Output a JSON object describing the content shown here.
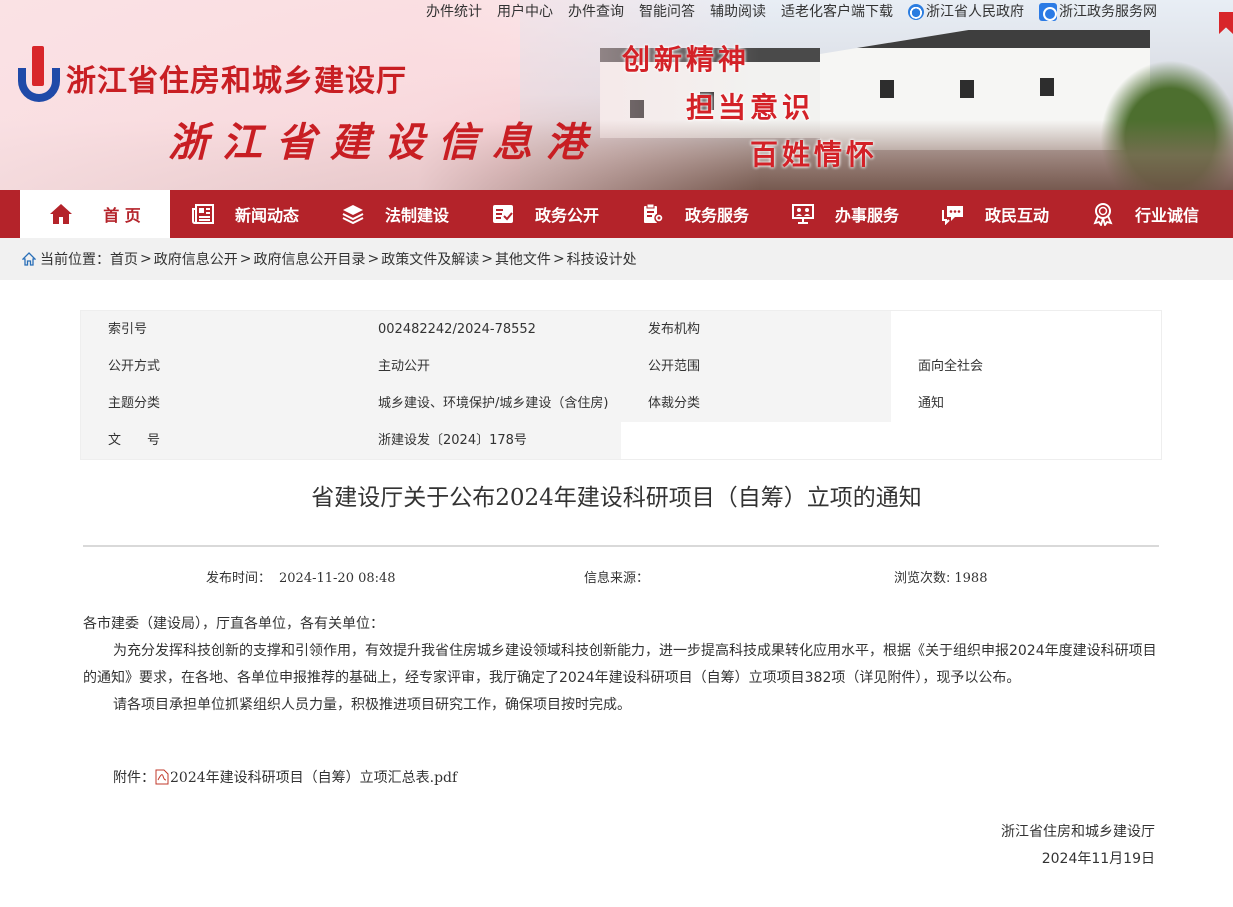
{
  "topbar": {
    "links": [
      "办件统计",
      "用户中心",
      "办件查询",
      "智能问答",
      "辅助阅读",
      "适老化客户端下载"
    ],
    "gov_link": "浙江省人民政府",
    "service_link": "浙江政务服务网"
  },
  "banner": {
    "org_name": "浙江省住房和城乡建设厅",
    "site_name": "浙江省建设信息港",
    "slogans": [
      "创新精神",
      "担当意识",
      "百姓情怀"
    ]
  },
  "nav": {
    "items": [
      {
        "label": "首 页",
        "icon": "home-icon"
      },
      {
        "label": "新闻动态",
        "icon": "newspaper-icon"
      },
      {
        "label": "法制建设",
        "icon": "layers-icon"
      },
      {
        "label": "政务公开",
        "icon": "document-check-icon"
      },
      {
        "label": "政务服务",
        "icon": "service-clipboard-icon"
      },
      {
        "label": "办事服务",
        "icon": "people-screen-icon"
      },
      {
        "label": "政民互动",
        "icon": "chat-icon"
      },
      {
        "label": "行业诚信",
        "icon": "award-ribbon-icon"
      }
    ],
    "colors": {
      "bar": "#b4232a",
      "active_bg": "#ffffff"
    }
  },
  "breadcrumb": {
    "prefix": "当前位置：",
    "items": [
      "首页",
      "政府信息公开",
      "政府信息公开目录",
      "政策文件及解读",
      "其他文件",
      "科技设计处"
    ],
    "separator": ">"
  },
  "meta": {
    "rows": [
      [
        "索引号",
        "002482242/2024-78552",
        "发布机构",
        ""
      ],
      [
        "公开方式",
        "主动公开",
        "公开范围",
        "面向全社会"
      ],
      [
        "主题分类",
        "城乡建设、环境保护/城乡建设（含住房)",
        "体裁分类",
        "通知"
      ],
      [
        "文　　号",
        "浙建设发〔2024〕178号",
        "",
        ""
      ]
    ]
  },
  "article": {
    "title": "省建设厅关于公布2024年建设科研项目（自筹）立项的通知",
    "publish_label": "发布时间：",
    "publish_time": "2024-11-20 08:48",
    "source_label": "信息来源：",
    "source_value": "",
    "views_label": "浏览次数:",
    "views": "1988",
    "salutation": "各市建委（建设局），厅直各单位，各有关单位：",
    "paragraph1": "为充分发挥科技创新的支撑和引领作用，有效提升我省住房城乡建设领域科技创新能力，进一步提高科技成果转化应用水平，根据《关于组织申报2024年度建设科研项目的通知》要求，在各地、各单位申报推荐的基础上，经专家评审，我厅确定了2024年建设科研项目（自筹）立项项目382项（详见附件），现予以公布。",
    "paragraph2": "请各项目承担单位抓紧组织人员力量，积极推进项目研究工作，确保项目按时完成。",
    "attachment_label": "附件：",
    "attachment_name": "2024年建设科研项目（自筹）立项汇总表.pdf",
    "signer": "浙江省住房和城乡建设厅",
    "sign_date": "2024年11月19日"
  }
}
